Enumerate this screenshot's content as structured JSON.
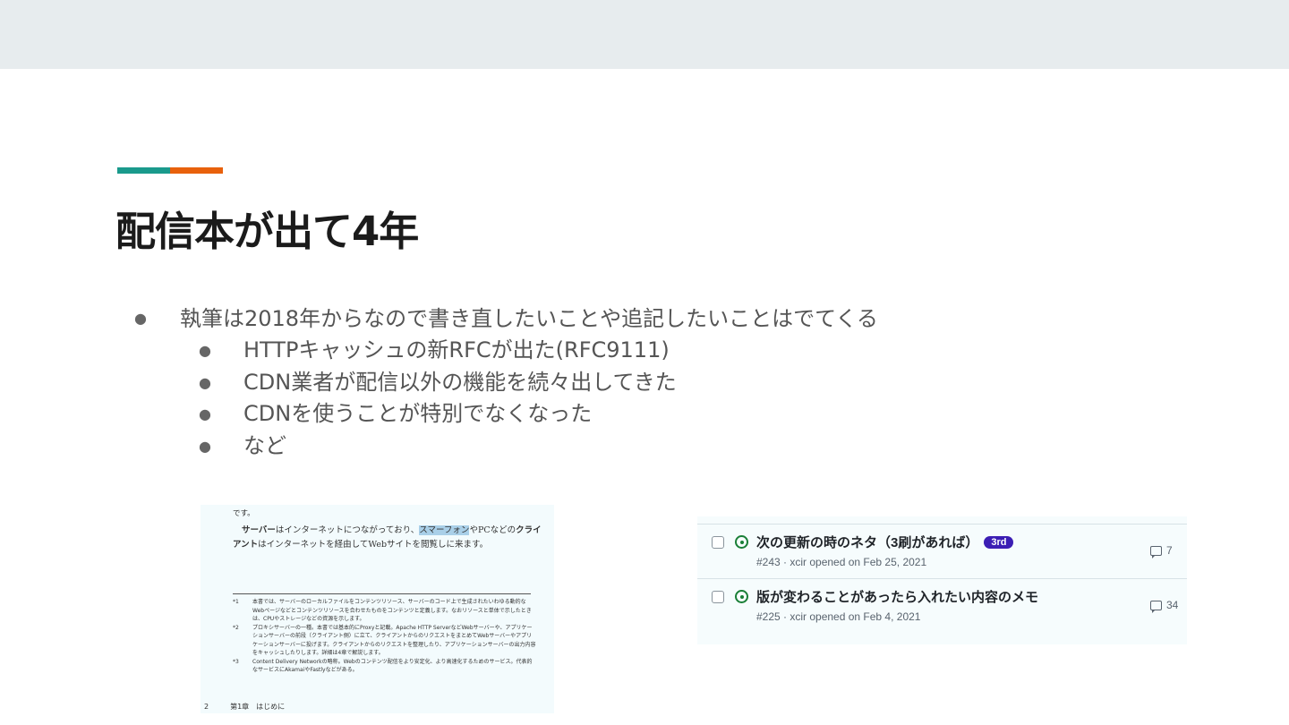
{
  "colors": {
    "accent_teal": "#1a9a8c",
    "accent_orange": "#e8610c",
    "topbar": "#e7ecee"
  },
  "slide": {
    "title": "配信本が出て4年",
    "bullet": "執筆は2018年からなので書き直したいことや追記したいことはでてくる",
    "bullet_marker": "●",
    "sub_bullets": [
      "HTTPキャッシュの新RFCが出た(RFC9111)",
      "CDN業者が配信以外の機能を続々出してきた",
      "CDNを使うことが特別でなくなった",
      "など"
    ]
  },
  "book_page": {
    "line0": "です。",
    "line1_bold": "サーバー",
    "line1_a": "はインターネットにつながっており、",
    "line1_hl": "スマーフォン",
    "line1_b": "やPCなどの",
    "line1_bold2": "クライ",
    "line2_bold": "アント",
    "line2_a": "はインターネットを経由してWebサイトを閲覧しに来ます。",
    "notes": [
      {
        "mark": "*1",
        "text": "本書では、サーバーのローカルファイルをコンテンツリソース、サーバーのコード上で生成されたいわゆる動的なWebページなどとコンテンツリソースを合わせたものをコンテンツと定義します。なおリソースと単体で示したときは、CPUやストレージなどの資源を示します。"
      },
      {
        "mark": "*2",
        "text": "プロキシサーバーの一種。本書では基本的にProxyと記載。Apache HTTP ServerなどWebサーバーや、アプリケーションサーバーの前段（クライアント側）に立て、クライアントからのリクエストをまとめてWebサーバーやアプリケーションサーバーに投げます。クライアントからのリクエストを整理したり、アプリケーションサーバーの出力内容をキャッシュしたりします。詳細は4章で解説します。"
      },
      {
        "mark": "*3",
        "text": "Content Delivery Networkの略称。Webのコンテンツ配信をより安定化、より高速化するためのサービス。代表的なサービスにAkamaiやFastlyなどがある。"
      }
    ],
    "page_number": "2",
    "chapter": "第1章　はじめに"
  },
  "issues": [
    {
      "title": "次の更新の時のネタ（3刷があれば）",
      "badge": "3rd",
      "meta": "#243 · xcir opened on Feb 25, 2021",
      "comments": "7"
    },
    {
      "title": "版が変わることがあったら入れたい内容のメモ",
      "badge": "",
      "meta": "#225 · xcir opened on Feb 4, 2021",
      "comments": "34"
    }
  ]
}
